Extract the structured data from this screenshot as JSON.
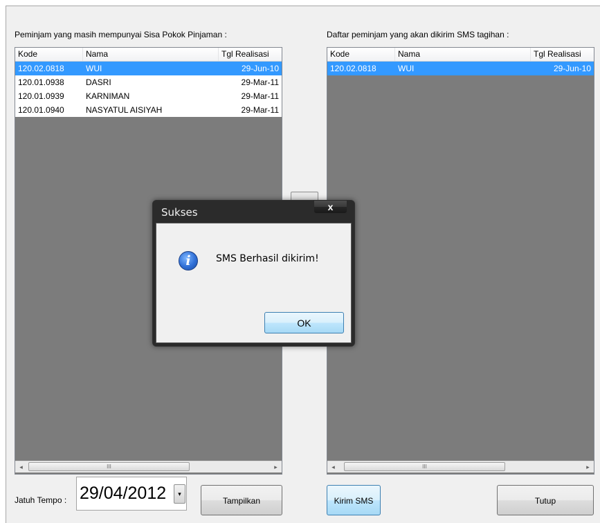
{
  "left_panel": {
    "caption": "Peminjam yang masih mempunyai Sisa Pokok Pinjaman :",
    "columns": [
      "Kode",
      "Nama",
      "Tgl Realisasi"
    ],
    "rows": [
      {
        "kode": "120.02.0818",
        "nama": "WUI",
        "tgl": "29-Jun-10",
        "selected": true
      },
      {
        "kode": "120.01.0938",
        "nama": "DASRI",
        "tgl": "29-Mar-11",
        "selected": false
      },
      {
        "kode": "120.01.0939",
        "nama": "KARNIMAN",
        "tgl": "29-Mar-11",
        "selected": false
      },
      {
        "kode": "120.01.0940",
        "nama": "NASYATUL AISIYAH",
        "tgl": "29-Mar-11",
        "selected": false
      }
    ]
  },
  "right_panel": {
    "caption": "Daftar peminjam yang akan dikirim SMS tagihan :",
    "columns": [
      "Kode",
      "Nama",
      "Tgl Realisasi"
    ],
    "rows": [
      {
        "kode": "120.02.0818",
        "nama": "WUI",
        "tgl": "29-Jun-10",
        "selected": true
      }
    ]
  },
  "scrollbar": {
    "thumb_glyph": "III",
    "left_arrow": "◂",
    "right_arrow": "▸"
  },
  "footer": {
    "due_label": "Jatuh Tempo :",
    "due_value": "29/04/2012",
    "dropdown_glyph": "▾",
    "show_button": "Tampilkan",
    "send_button": "Kirim SMS",
    "close_button": "Tutup"
  },
  "dialog": {
    "title": "Sukses",
    "close_glyph": "x",
    "icon": "info-icon",
    "icon_glyph": "i",
    "message": "SMS Berhasil dikirim!",
    "ok_label": "OK"
  }
}
